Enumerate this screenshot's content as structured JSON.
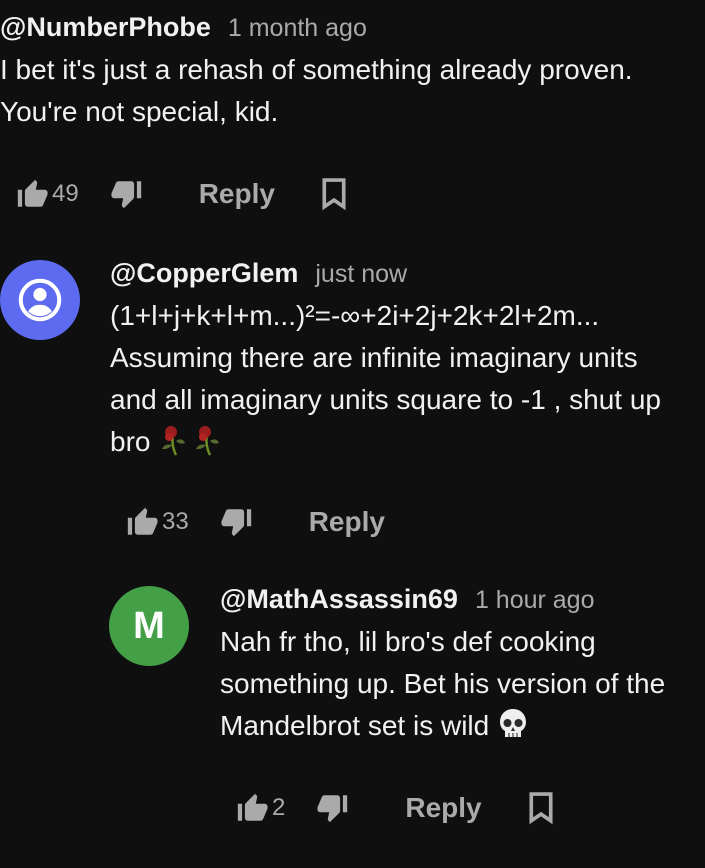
{
  "comments": [
    {
      "author": "@NumberPhobe",
      "time": "1 month ago",
      "text": "I bet it's just a rehash of something already proven.\nYou're not special, kid.",
      "likes": "49",
      "reply_label": "Reply"
    },
    {
      "author": "@CopperGlem",
      "time": "just now",
      "text": "(1+l+j+k+l+m...)²=-∞+2i+2j+2k+2l+2m...\nAssuming there are infinite imaginary units\nand all imaginary units square to -1 , shut up\nbro",
      "likes": "33",
      "reply_label": "Reply",
      "avatar_color": "#5c6bf0",
      "avatar_icon": "person-icon"
    },
    {
      "author": "@MathAssassin69",
      "time": "1 hour ago",
      "text": "Nah fr tho, lil bro's def cooking\nsomething up. Bet his version of the\nMandelbrot set is wild",
      "likes": "2",
      "reply_label": "Reply",
      "avatar_letter": "M",
      "avatar_color": "#43a047"
    }
  ]
}
